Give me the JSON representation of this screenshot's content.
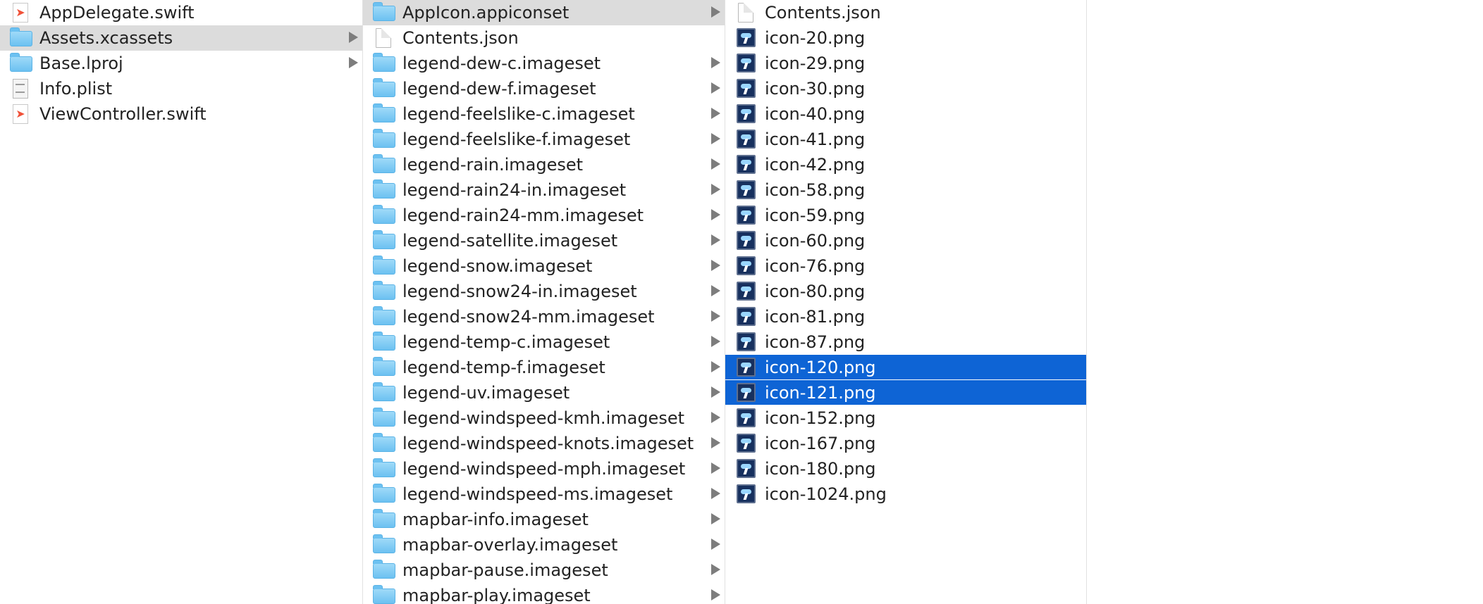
{
  "columns": [
    {
      "id": "col-1",
      "items": [
        {
          "name": "AppDelegate.swift",
          "kind": "swift",
          "icon": "swift-file-icon",
          "has_children": false,
          "selection": "none"
        },
        {
          "name": "Assets.xcassets",
          "kind": "folder",
          "icon": "folder-icon",
          "has_children": true,
          "selection": "inactive"
        },
        {
          "name": "Base.lproj",
          "kind": "folder",
          "icon": "folder-icon",
          "has_children": true,
          "selection": "none"
        },
        {
          "name": "Info.plist",
          "kind": "plist",
          "icon": "plist-file-icon",
          "has_children": false,
          "selection": "none"
        },
        {
          "name": "ViewController.swift",
          "kind": "swift",
          "icon": "swift-file-icon",
          "has_children": false,
          "selection": "none"
        }
      ]
    },
    {
      "id": "col-2",
      "items": [
        {
          "name": "AppIcon.appiconset",
          "kind": "folder",
          "icon": "folder-icon",
          "has_children": true,
          "selection": "inactive"
        },
        {
          "name": "Contents.json",
          "kind": "doc",
          "icon": "document-icon",
          "has_children": false,
          "selection": "none"
        },
        {
          "name": "legend-dew-c.imageset",
          "kind": "folder",
          "icon": "folder-icon",
          "has_children": true,
          "selection": "none"
        },
        {
          "name": "legend-dew-f.imageset",
          "kind": "folder",
          "icon": "folder-icon",
          "has_children": true,
          "selection": "none"
        },
        {
          "name": "legend-feelslike-c.imageset",
          "kind": "folder",
          "icon": "folder-icon",
          "has_children": true,
          "selection": "none"
        },
        {
          "name": "legend-feelslike-f.imageset",
          "kind": "folder",
          "icon": "folder-icon",
          "has_children": true,
          "selection": "none"
        },
        {
          "name": "legend-rain.imageset",
          "kind": "folder",
          "icon": "folder-icon",
          "has_children": true,
          "selection": "none"
        },
        {
          "name": "legend-rain24-in.imageset",
          "kind": "folder",
          "icon": "folder-icon",
          "has_children": true,
          "selection": "none"
        },
        {
          "name": "legend-rain24-mm.imageset",
          "kind": "folder",
          "icon": "folder-icon",
          "has_children": true,
          "selection": "none"
        },
        {
          "name": "legend-satellite.imageset",
          "kind": "folder",
          "icon": "folder-icon",
          "has_children": true,
          "selection": "none"
        },
        {
          "name": "legend-snow.imageset",
          "kind": "folder",
          "icon": "folder-icon",
          "has_children": true,
          "selection": "none"
        },
        {
          "name": "legend-snow24-in.imageset",
          "kind": "folder",
          "icon": "folder-icon",
          "has_children": true,
          "selection": "none"
        },
        {
          "name": "legend-snow24-mm.imageset",
          "kind": "folder",
          "icon": "folder-icon",
          "has_children": true,
          "selection": "none"
        },
        {
          "name": "legend-temp-c.imageset",
          "kind": "folder",
          "icon": "folder-icon",
          "has_children": true,
          "selection": "none"
        },
        {
          "name": "legend-temp-f.imageset",
          "kind": "folder",
          "icon": "folder-icon",
          "has_children": true,
          "selection": "none"
        },
        {
          "name": "legend-uv.imageset",
          "kind": "folder",
          "icon": "folder-icon",
          "has_children": true,
          "selection": "none"
        },
        {
          "name": "legend-windspeed-kmh.imageset",
          "kind": "folder",
          "icon": "folder-icon",
          "has_children": true,
          "selection": "none"
        },
        {
          "name": "legend-windspeed-knots.imageset",
          "kind": "folder",
          "icon": "folder-icon",
          "has_children": true,
          "selection": "none"
        },
        {
          "name": "legend-windspeed-mph.imageset",
          "kind": "folder",
          "icon": "folder-icon",
          "has_children": true,
          "selection": "none"
        },
        {
          "name": "legend-windspeed-ms.imageset",
          "kind": "folder",
          "icon": "folder-icon",
          "has_children": true,
          "selection": "none"
        },
        {
          "name": "mapbar-info.imageset",
          "kind": "folder",
          "icon": "folder-icon",
          "has_children": true,
          "selection": "none"
        },
        {
          "name": "mapbar-overlay.imageset",
          "kind": "folder",
          "icon": "folder-icon",
          "has_children": true,
          "selection": "none"
        },
        {
          "name": "mapbar-pause.imageset",
          "kind": "folder",
          "icon": "folder-icon",
          "has_children": true,
          "selection": "none"
        },
        {
          "name": "mapbar-play.imageset",
          "kind": "folder",
          "icon": "folder-icon",
          "has_children": true,
          "selection": "none"
        }
      ]
    },
    {
      "id": "col-3",
      "items": [
        {
          "name": "Contents.json",
          "kind": "doc",
          "icon": "document-icon",
          "has_children": false,
          "selection": "none"
        },
        {
          "name": "icon-20.png",
          "kind": "png",
          "icon": "png-image-icon",
          "has_children": false,
          "selection": "none"
        },
        {
          "name": "icon-29.png",
          "kind": "png",
          "icon": "png-image-icon",
          "has_children": false,
          "selection": "none"
        },
        {
          "name": "icon-30.png",
          "kind": "png",
          "icon": "png-image-icon",
          "has_children": false,
          "selection": "none"
        },
        {
          "name": "icon-40.png",
          "kind": "png",
          "icon": "png-image-icon",
          "has_children": false,
          "selection": "none"
        },
        {
          "name": "icon-41.png",
          "kind": "png",
          "icon": "png-image-icon",
          "has_children": false,
          "selection": "none"
        },
        {
          "name": "icon-42.png",
          "kind": "png",
          "icon": "png-image-icon",
          "has_children": false,
          "selection": "none"
        },
        {
          "name": "icon-58.png",
          "kind": "png",
          "icon": "png-image-icon",
          "has_children": false,
          "selection": "none"
        },
        {
          "name": "icon-59.png",
          "kind": "png",
          "icon": "png-image-icon",
          "has_children": false,
          "selection": "none"
        },
        {
          "name": "icon-60.png",
          "kind": "png",
          "icon": "png-image-icon",
          "has_children": false,
          "selection": "none"
        },
        {
          "name": "icon-76.png",
          "kind": "png",
          "icon": "png-image-icon",
          "has_children": false,
          "selection": "none"
        },
        {
          "name": "icon-80.png",
          "kind": "png",
          "icon": "png-image-icon",
          "has_children": false,
          "selection": "none"
        },
        {
          "name": "icon-81.png",
          "kind": "png",
          "icon": "png-image-icon",
          "has_children": false,
          "selection": "none"
        },
        {
          "name": "icon-87.png",
          "kind": "png",
          "icon": "png-image-icon",
          "has_children": false,
          "selection": "none"
        },
        {
          "name": "icon-120.png",
          "kind": "png",
          "icon": "png-image-icon",
          "has_children": false,
          "selection": "active"
        },
        {
          "name": "icon-121.png",
          "kind": "png",
          "icon": "png-image-icon",
          "has_children": false,
          "selection": "active"
        },
        {
          "name": "icon-152.png",
          "kind": "png",
          "icon": "png-image-icon",
          "has_children": false,
          "selection": "none"
        },
        {
          "name": "icon-167.png",
          "kind": "png",
          "icon": "png-image-icon",
          "has_children": false,
          "selection": "none"
        },
        {
          "name": "icon-180.png",
          "kind": "png",
          "icon": "png-image-icon",
          "has_children": false,
          "selection": "none"
        },
        {
          "name": "icon-1024.png",
          "kind": "png",
          "icon": "png-image-icon",
          "has_children": false,
          "selection": "none"
        }
      ]
    }
  ],
  "colors": {
    "selection_active": "#0e64d5",
    "selection_inactive": "#dcdcdc",
    "disclosure_arrow": "#7d7d7d",
    "column_divider": "#e1e1e1"
  }
}
